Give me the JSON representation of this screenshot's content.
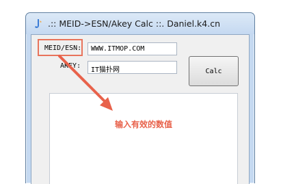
{
  "window": {
    "title": ".:: MEID->ESN/Akey Calc ::. Daniel.k4.cn"
  },
  "form": {
    "meid_label": "MEID/ESN:",
    "meid_value": "WWW.ITMOP.COM",
    "akey_label": "AKEY:",
    "akey_value": "IT猫扑网",
    "calc_label": "Calc",
    "output_value": ""
  },
  "annotation": {
    "text": "输入有效的数值",
    "color": "#e8624b"
  },
  "icons": {
    "app": "app-icon",
    "arrow": "annotation-arrow"
  }
}
